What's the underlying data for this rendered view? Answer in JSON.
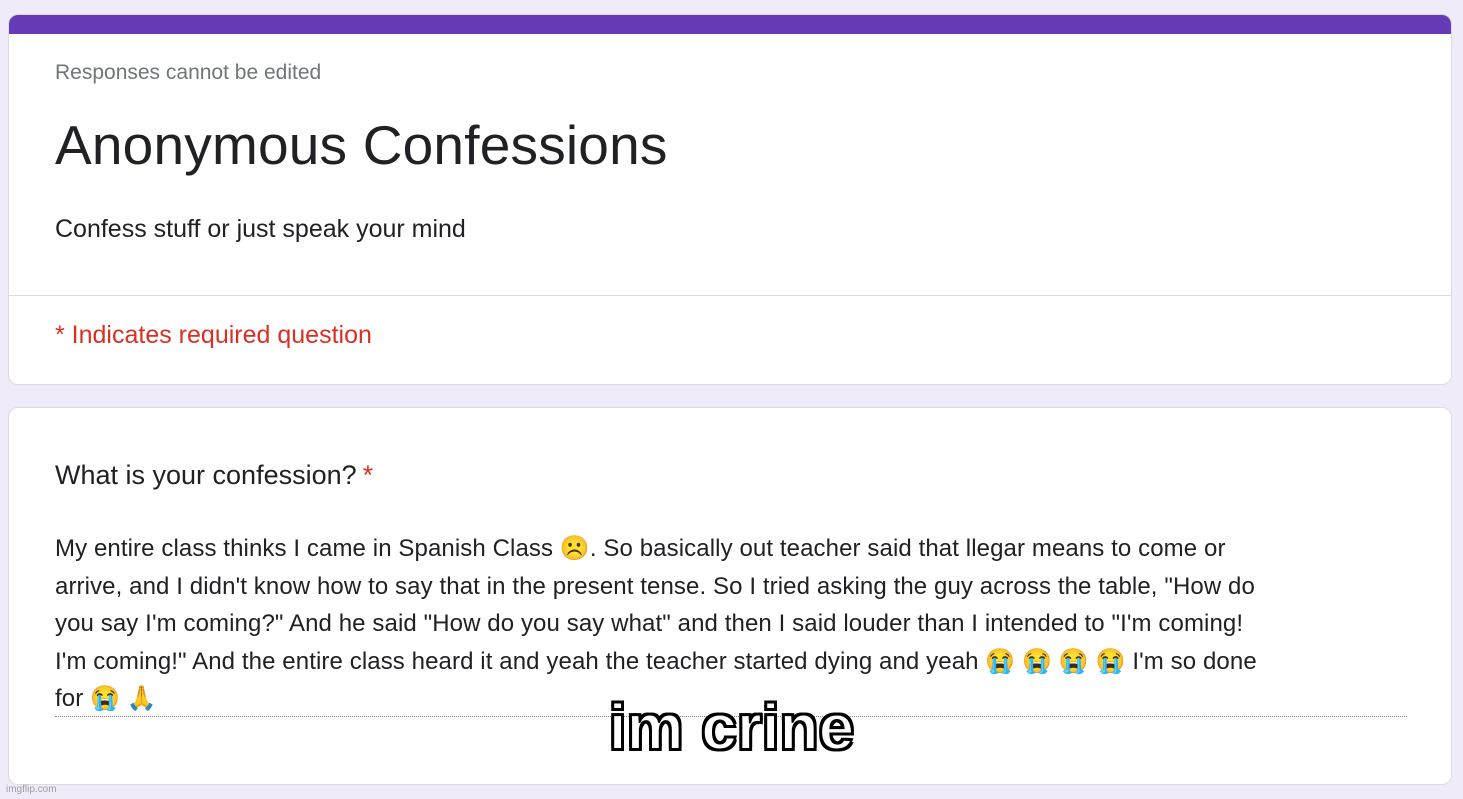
{
  "colors": {
    "accent": "#673ab7",
    "required": "#d93025",
    "background": "#f0ebf8"
  },
  "header": {
    "notice": "Responses cannot be edited",
    "title": "Anonymous Confessions",
    "description": "Confess stuff or just speak your mind",
    "required_note": "* Indicates required question"
  },
  "question": {
    "label": "What is your confession?",
    "required_marker": "*",
    "answer": "My entire class thinks I came in Spanish Class ☹️. So basically out teacher said that llegar means to come or\narrive, and I didn't know how to say that in the present tense. So I tried asking the guy across the table, \"How do\nyou say I'm coming?\" And he said \"How do you say what\" and then I said louder than I intended to \"I'm coming!\nI'm coming!\" And the entire class heard it and yeah the teacher started dying and yeah 😭 😭 😭 😭 I'm so done\nfor 😭 🙏"
  },
  "caption": "im crine",
  "watermark": "imgflip.com"
}
